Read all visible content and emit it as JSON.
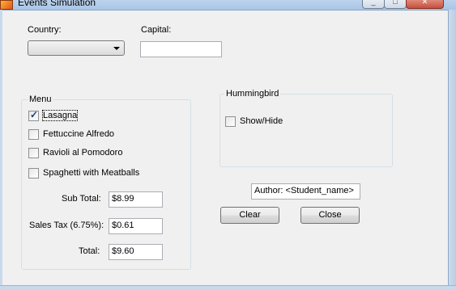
{
  "window": {
    "title": "Events Simulation",
    "min_glyph": "_",
    "max_glyph": "□",
    "close_glyph": "✕"
  },
  "country": {
    "label": "Country:",
    "selected": ""
  },
  "capital": {
    "label": "Capital:",
    "value": ""
  },
  "menu": {
    "title": "Menu",
    "items": [
      {
        "label": "Lasagna",
        "checked": true
      },
      {
        "label": "Fettuccine Alfredo",
        "checked": false
      },
      {
        "label": "Ravioli al Pomodoro",
        "checked": false
      },
      {
        "label": "Spaghetti with Meatballs",
        "checked": false
      }
    ],
    "subtotal_label": "Sub Total:",
    "subtotal_value": "$8.99",
    "tax_label": "Sales Tax (6.75%):",
    "tax_value": "$0.61",
    "total_label": "Total:",
    "total_value": "$9.60"
  },
  "hummingbird": {
    "title": "Hummingbird",
    "toggle_label": "Show/Hide",
    "checked": false
  },
  "author": {
    "value": "Author: <Student_name>"
  },
  "buttons": {
    "clear": "Clear",
    "close": "Close"
  },
  "check_glyph": "✓"
}
